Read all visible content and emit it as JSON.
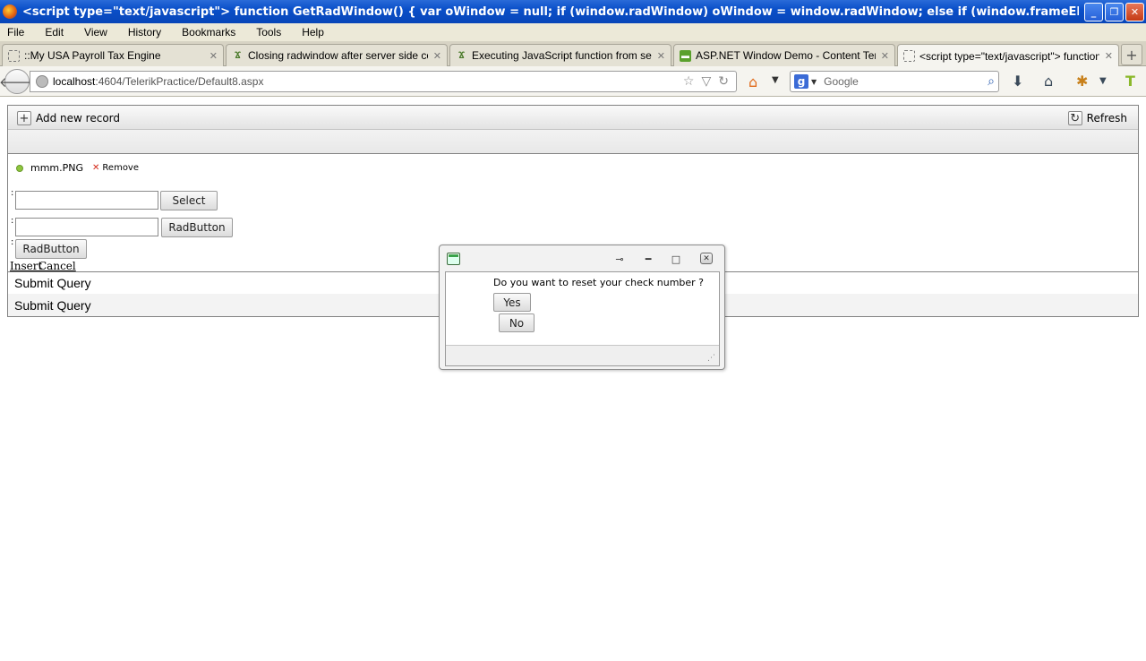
{
  "window": {
    "title": "<script type=\"text/javascript\"> function GetRadWindow() { var oWindow = null; if (window.radWindow) oWindow = window.radWindow; else if (window.frameElement && window.frameEle..."
  },
  "menu": {
    "items": [
      "File",
      "Edit",
      "View",
      "History",
      "Bookmarks",
      "Tools",
      "Help"
    ]
  },
  "tabs": [
    {
      "label": "::My USA Payroll Tax Engine",
      "icon": "blank-page-icon"
    },
    {
      "label": "Closing radwindow after server side code...",
      "icon": "telerik-icon"
    },
    {
      "label": "Executing JavaScript function from serve...",
      "icon": "telerik-icon"
    },
    {
      "label": "ASP.NET Window Demo - Content Template",
      "icon": "demo-icon"
    },
    {
      "label": "<script type=\"text/javascript\"> function...",
      "icon": "blank-page-icon",
      "active": true
    }
  ],
  "nav": {
    "url_host": "localhost",
    "url_rest": ":4604/TelerikPractice/Default8.aspx",
    "search_placeholder": "Google"
  },
  "grid": {
    "add_label": "Add new record",
    "refresh_label": "Refresh",
    "upload_filename": "mmm.PNG",
    "remove_label": "Remove",
    "select_label": "Select",
    "radbutton_label": "RadButton",
    "radbutton2_label": "RadButton",
    "colon": ":",
    "insert_label": "Insert",
    "cancel_label": "Cancel",
    "submit_rows": [
      "Submit Query",
      "Submit Query"
    ]
  },
  "dialog": {
    "question": "Do you want to reset your check number ?",
    "yes_label": "Yes",
    "no_label": "No"
  },
  "colors": {
    "titlebar": "#0a4fc9",
    "chrome": "#ece9d8",
    "accent_green": "#8ec63f",
    "remove_red": "#d42a1a"
  }
}
